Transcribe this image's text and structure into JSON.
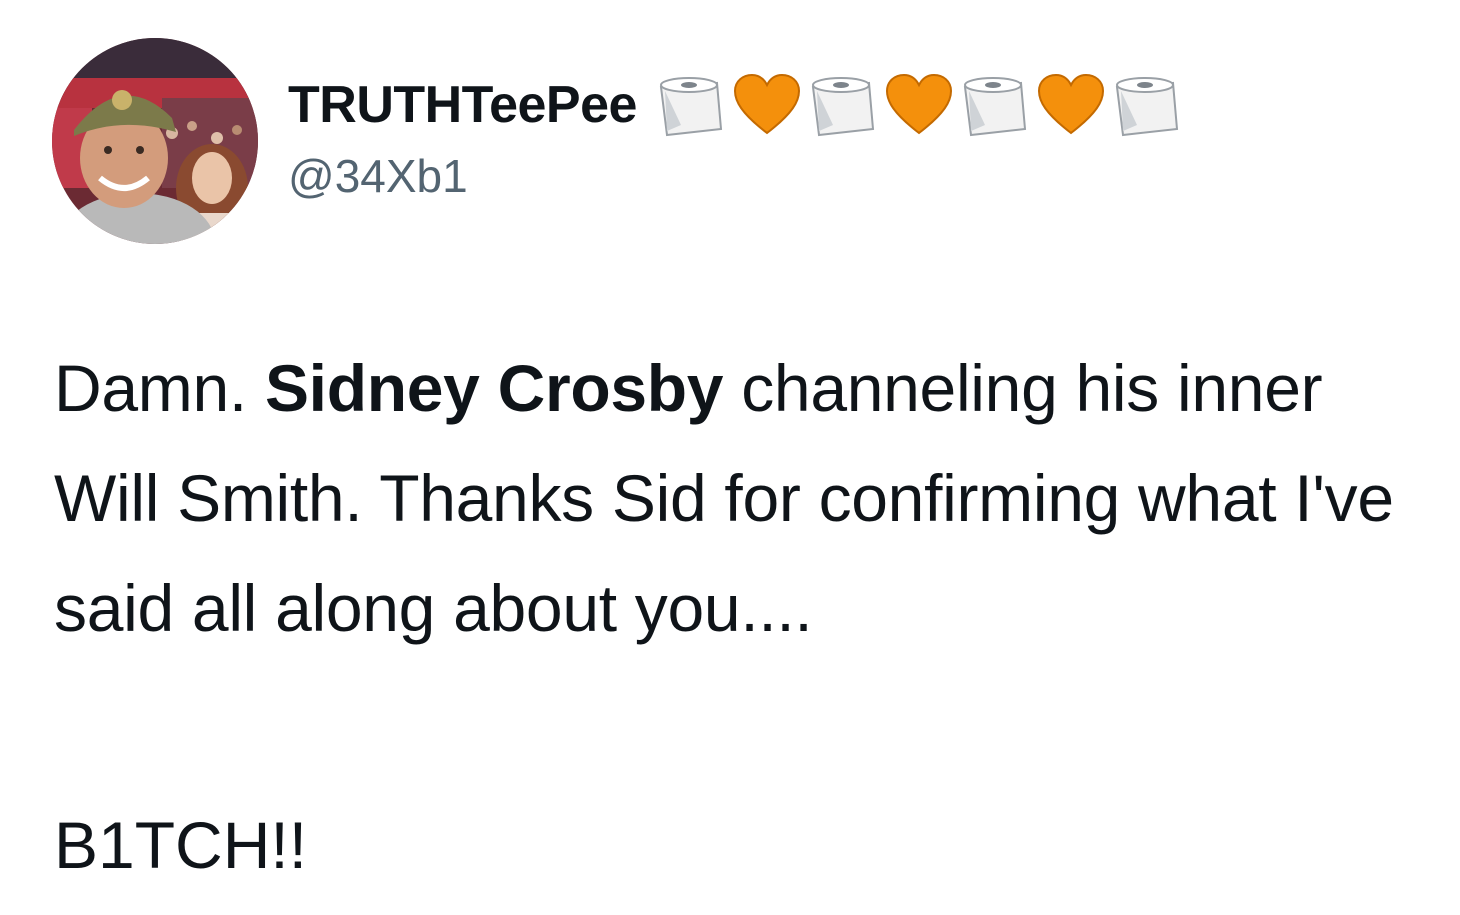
{
  "author": {
    "display_name": "TRUTHTeePee",
    "handle": "@34Xb1",
    "name_emojis": [
      "toilet-paper",
      "orange-heart",
      "toilet-paper",
      "orange-heart",
      "toilet-paper",
      "orange-heart",
      "toilet-paper"
    ]
  },
  "tweet": {
    "text_before": "Damn. ",
    "text_bold": "Sidney Crosby",
    "text_after": " channeling his inner Will Smith. Thanks Sid for confirming what I've said all along about you....",
    "closing_line": "B1TCH!!"
  },
  "colors": {
    "text": "#0f1419",
    "secondary_text": "#536471",
    "orange_heart": "#f4900c"
  }
}
